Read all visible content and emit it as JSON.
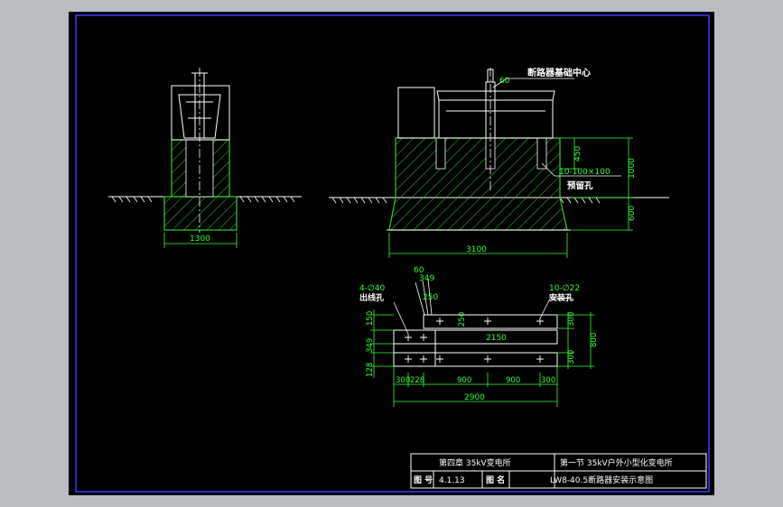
{
  "colors": {
    "background": "#000000",
    "frame_blue": "#3a3aff",
    "drawing_white": "#ffffff",
    "dimension_green": "#33ff33",
    "hatch_green": "#2bd12b",
    "cyan": "#00e5ff",
    "title_yellow": "#ffff66"
  },
  "section_view": {
    "dims": {
      "width": "1300"
    }
  },
  "front_view": {
    "callouts": {
      "center": "断路器基础中心",
      "offset": "60",
      "holes": "10-100×100",
      "holes_name": "预留孔"
    },
    "dims": {
      "width": "3100",
      "top": "450",
      "total": "1000",
      "bottom": "600"
    }
  },
  "plan_view": {
    "callouts": {
      "left_count": "4-∅40",
      "left_name": "出线孔",
      "right_count": "10-∅22",
      "right_name": "安装孔"
    },
    "dims": {
      "top_60": "60",
      "top_349": "349",
      "d250": "250",
      "d150": "150",
      "d250b": "250",
      "d2150": "2150",
      "d349": "349",
      "d128": "128",
      "d300a": "300",
      "d228": "228",
      "d900a": "900",
      "d900b": "900",
      "d300b": "300",
      "d2900": "2900",
      "r300a": "300",
      "r300b": "300",
      "r800": "800"
    }
  },
  "title_block": {
    "chapter": "第四章  35kV变电所",
    "section": "第一节  35kV户外小型化变电所",
    "drawing_no_label": "图 号",
    "drawing_no": "4.1.13",
    "drawing_name_label": "图 名",
    "drawing_name": "LW8-40.5断路器安装示意图"
  }
}
